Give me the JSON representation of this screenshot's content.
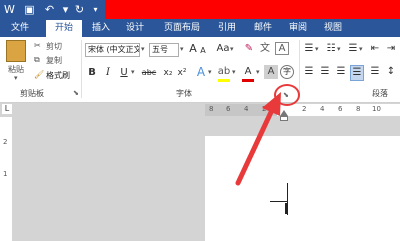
{
  "title_bar": {
    "save_icon": "save-icon",
    "undo_icon": "undo-icon",
    "redo_icon": "redo-icon"
  },
  "tabs": [
    "文件",
    "开始",
    "插入",
    "设计",
    "页面布局",
    "引用",
    "邮件",
    "审阅",
    "视图"
  ],
  "clipboard": {
    "paste": "粘贴",
    "cut": "剪切",
    "copy": "复制",
    "format_painter": "格式刷",
    "group": "剪贴板"
  },
  "font": {
    "name": "宋体 (中文正文)",
    "size": "五号",
    "grow": "A",
    "shrink": "A",
    "case": "Aa",
    "bold": "B",
    "italic": "I",
    "underline": "U",
    "strike": "abc",
    "sub": "x₂",
    "sup": "x²",
    "group": "字体"
  },
  "paragraph": {
    "group": "段落"
  },
  "ruler": [
    "8",
    "6",
    "4",
    "2",
    "2",
    "4",
    "6",
    "8",
    "10"
  ],
  "vruler": [
    "2",
    "1"
  ],
  "layout_marker": "L",
  "colors": {
    "accent": "#2b579a",
    "annotation": "#e83a3a"
  }
}
